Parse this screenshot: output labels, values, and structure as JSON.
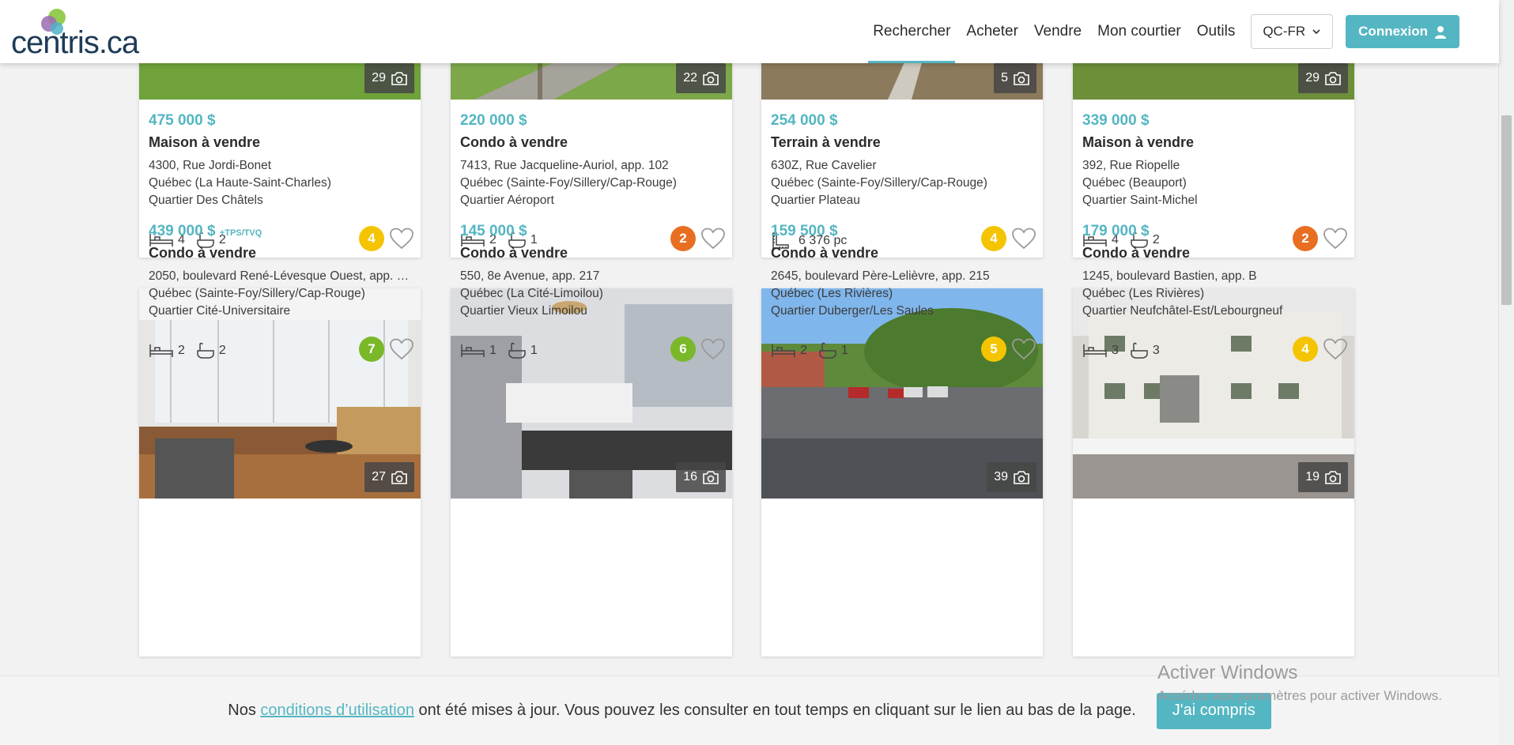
{
  "brand": {
    "name": "centris",
    "tld": ".ca",
    "colors": {
      "accent": "#54b6c2",
      "navy": "#1e3b57"
    }
  },
  "nav": {
    "items": [
      {
        "label": "Rechercher",
        "active": true
      },
      {
        "label": "Acheter"
      },
      {
        "label": "Vendre"
      },
      {
        "label": "Mon courtier"
      },
      {
        "label": "Outils"
      }
    ],
    "language": "QC-FR",
    "login": "Connexion"
  },
  "listings": [
    {
      "photos": "29",
      "price": "475 000 $",
      "tax": "",
      "type": "Maison à vendre",
      "address": "4300, Rue Jordi-Bonet",
      "city": "Québec (La Haute-Saint-Charles)",
      "district": "Quartier Des Châtels",
      "beds": "4",
      "baths": "2",
      "area": "",
      "score": "4",
      "score_color": "#f5c400"
    },
    {
      "photos": "22",
      "price": "220 000 $",
      "tax": "",
      "type": "Condo à vendre",
      "address": "7413, Rue Jacqueline-Auriol, app. 102",
      "city": "Québec (Sainte-Foy/Sillery/Cap-Rouge)",
      "district": "Quartier Aéroport",
      "beds": "2",
      "baths": "1",
      "area": "",
      "score": "2",
      "score_color": "#e86f22"
    },
    {
      "photos": "5",
      "price": "254 000 $",
      "tax": "",
      "type": "Terrain à vendre",
      "address": "630Z, Rue Cavelier",
      "city": "Québec (Sainte-Foy/Sillery/Cap-Rouge)",
      "district": "Quartier Plateau",
      "beds": "",
      "baths": "",
      "area": "6 376 pc",
      "score": "4",
      "score_color": "#f5c400"
    },
    {
      "photos": "29",
      "price": "339 000 $",
      "tax": "",
      "type": "Maison à vendre",
      "address": "392, Rue Riopelle",
      "city": "Québec (Beauport)",
      "district": "Quartier Saint-Michel",
      "beds": "4",
      "baths": "2",
      "area": "",
      "score": "2",
      "score_color": "#e86f22"
    },
    {
      "photos": "27",
      "price": "439 000 $",
      "tax": "+TPS/TVQ",
      "type": "Condo à vendre",
      "address": "2050, boulevard René-Lévesque Ouest, app. 5...",
      "city": "Québec (Sainte-Foy/Sillery/Cap-Rouge)",
      "district": "Quartier Cité-Universitaire",
      "beds": "2",
      "baths": "2",
      "area": "",
      "score": "7",
      "score_color": "#7ab829"
    },
    {
      "photos": "16",
      "price": "145 000 $",
      "tax": "",
      "type": "Condo à vendre",
      "address": "550, 8e Avenue, app. 217",
      "city": "Québec (La Cité-Limoilou)",
      "district": "Quartier Vieux Limoilou",
      "beds": "1",
      "baths": "1",
      "area": "",
      "score": "6",
      "score_color": "#7ab829"
    },
    {
      "photos": "39",
      "price": "159 500 $",
      "tax": "",
      "type": "Condo à vendre",
      "address": "2645, boulevard Père-Lelièvre, app. 215",
      "city": "Québec (Les Rivières)",
      "district": "Quartier Duberger/Les Saules",
      "beds": "2",
      "baths": "1",
      "area": "",
      "score": "5",
      "score_color": "#f5c400"
    },
    {
      "photos": "19",
      "price": "179 000 $",
      "tax": "",
      "type": "Condo à vendre",
      "address": "1245, boulevard Bastien, app. B",
      "city": "Québec (Les Rivières)",
      "district": "Quartier Neufchâtel-Est/Lebourgneuf",
      "beds": "3",
      "baths": "3",
      "area": "",
      "score": "4",
      "score_color": "#f5c400"
    }
  ],
  "cookie": {
    "before": "Nos ",
    "link": "conditions d’utilisation",
    "after": " ont été mises à jour. Vous pouvez les consulter en tout temps en cliquant sur le lien au bas de la page.",
    "button": "J'ai compris"
  },
  "watermark": {
    "title": "Activer Windows",
    "subtitle": "Accédez aux paramètres pour activer Windows."
  }
}
